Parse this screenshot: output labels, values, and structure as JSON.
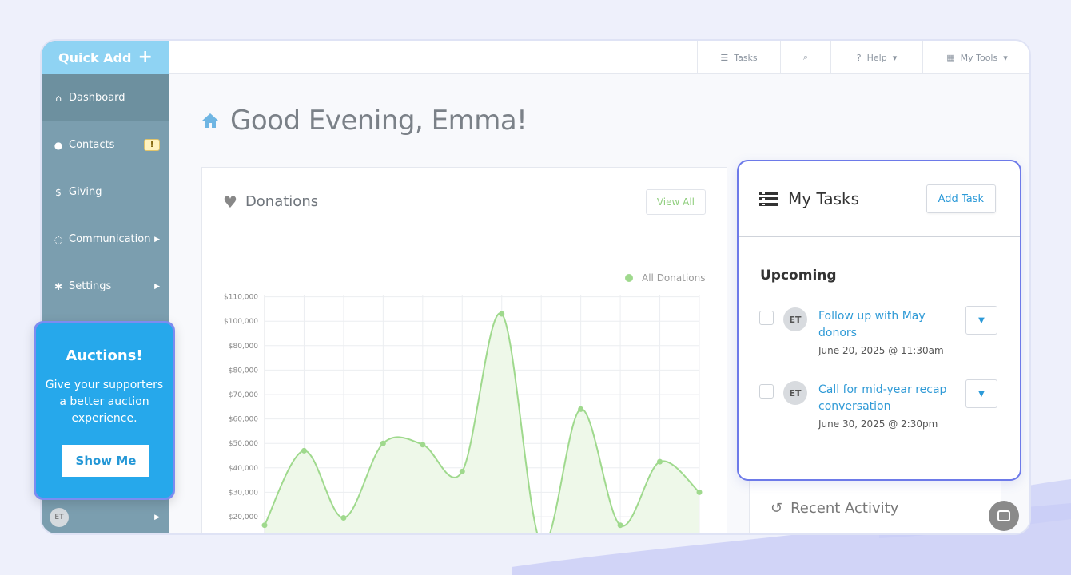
{
  "sidebar": {
    "quick_add": "Quick Add",
    "items": [
      {
        "label": "Dashboard",
        "icon": "home-icon"
      },
      {
        "label": "Contacts",
        "icon": "user-icon",
        "badge": "!"
      },
      {
        "label": "Giving",
        "icon": "dollar-icon"
      },
      {
        "label": "Communication",
        "icon": "chat-icon"
      },
      {
        "label": "Settings",
        "icon": "gear-icon"
      }
    ],
    "user_initials": "ET"
  },
  "topbar": {
    "tasks": "Tasks",
    "help": "Help",
    "my_tools": "My Tools"
  },
  "greeting": "Good Evening, Emma!",
  "donations": {
    "title": "Donations",
    "view_all": "View All",
    "legend": "All Donations"
  },
  "chart_data": {
    "type": "area",
    "legend": "All Donations",
    "y_ticks": [
      "$20,000",
      "$30,000",
      "$40,000",
      "$50,000",
      "$60,000",
      "$70,000",
      "$80,000",
      "$80,000",
      "$100,000",
      "$110,000"
    ],
    "values": [
      16500,
      47000,
      19500,
      50000,
      49500,
      38500,
      103000,
      9000,
      64000,
      16500,
      42500,
      30000
    ],
    "ylim": [
      15000,
      110000
    ],
    "colors": {
      "line": "#9fd98d",
      "fill": "#eef8e9"
    }
  },
  "tasks": {
    "title": "My Tasks",
    "add_task": "Add Task",
    "section": "Upcoming",
    "items": [
      {
        "initials": "ET",
        "title": "Follow up with May donors",
        "date": "June 20, 2025 @ 11:30am"
      },
      {
        "initials": "ET",
        "title": "Call for mid-year recap conversation",
        "date": "June 30, 2025 @ 2:30pm"
      }
    ]
  },
  "recent_activity": {
    "title": "Recent Activity"
  },
  "promo": {
    "title": "Auctions!",
    "body": "Give your supporters a better auction experience.",
    "button": "Show Me"
  }
}
